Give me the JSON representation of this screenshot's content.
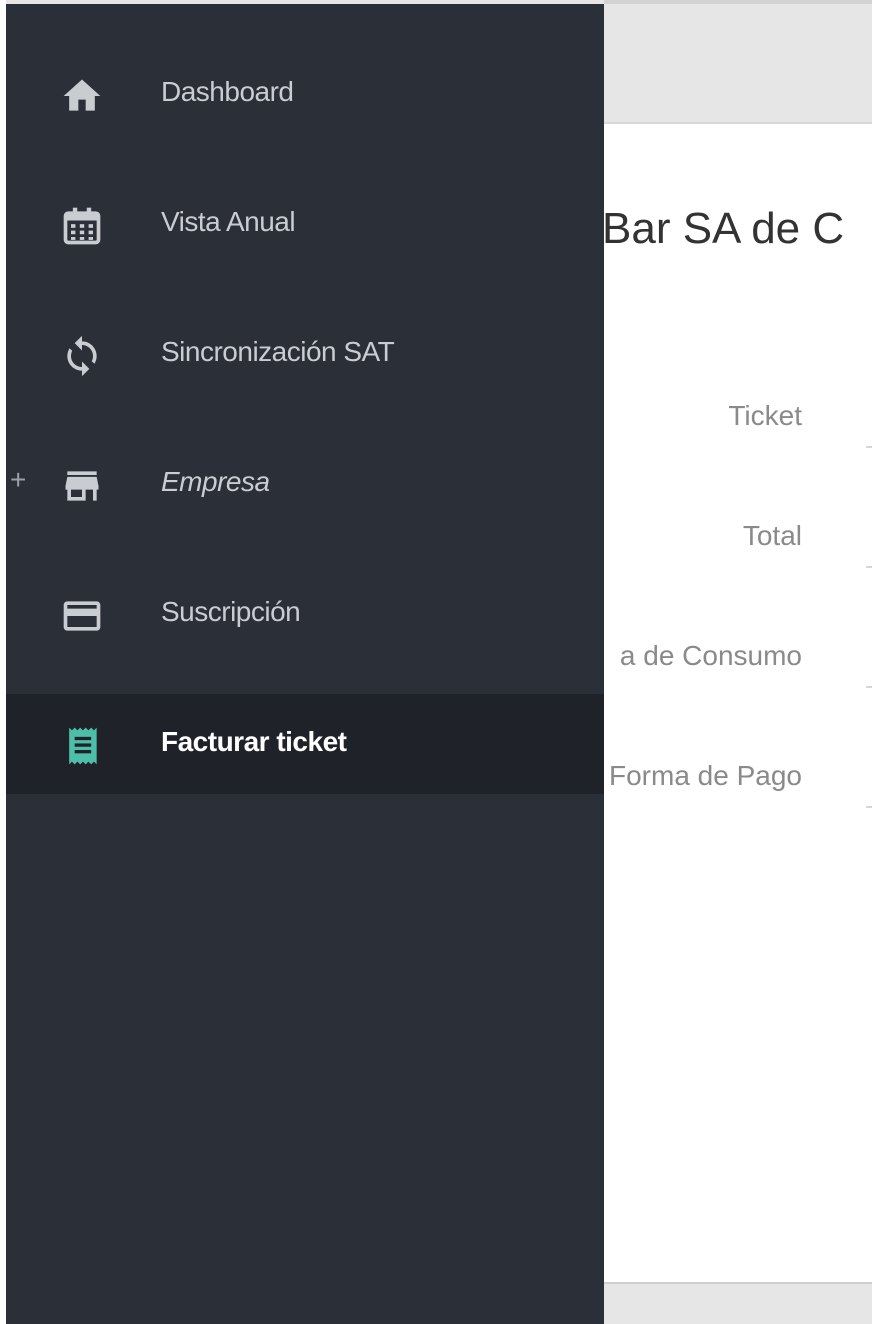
{
  "content": {
    "company_title": "Bar SA de C",
    "form_fields": [
      {
        "label": "Ticket"
      },
      {
        "label": "Total"
      },
      {
        "label": "a de Consumo"
      },
      {
        "label": "Forma de Pago"
      }
    ]
  },
  "sidebar": {
    "items": [
      {
        "label": "Dashboard",
        "icon": "home-icon"
      },
      {
        "label": "Vista Anual",
        "icon": "calendar-icon"
      },
      {
        "label": "Sincronización SAT",
        "icon": "sync-icon"
      },
      {
        "label": "Empresa",
        "icon": "store-icon",
        "expand": "+"
      },
      {
        "label": "Suscripción",
        "icon": "credit-card-icon"
      },
      {
        "label": "Facturar ticket",
        "icon": "receipt-icon",
        "active": true
      }
    ]
  },
  "colors": {
    "drawer_bg": "#2b2f37",
    "active_bg": "#1f2228",
    "accent": "#4dbfa8",
    "text": "#c9ccd1"
  }
}
